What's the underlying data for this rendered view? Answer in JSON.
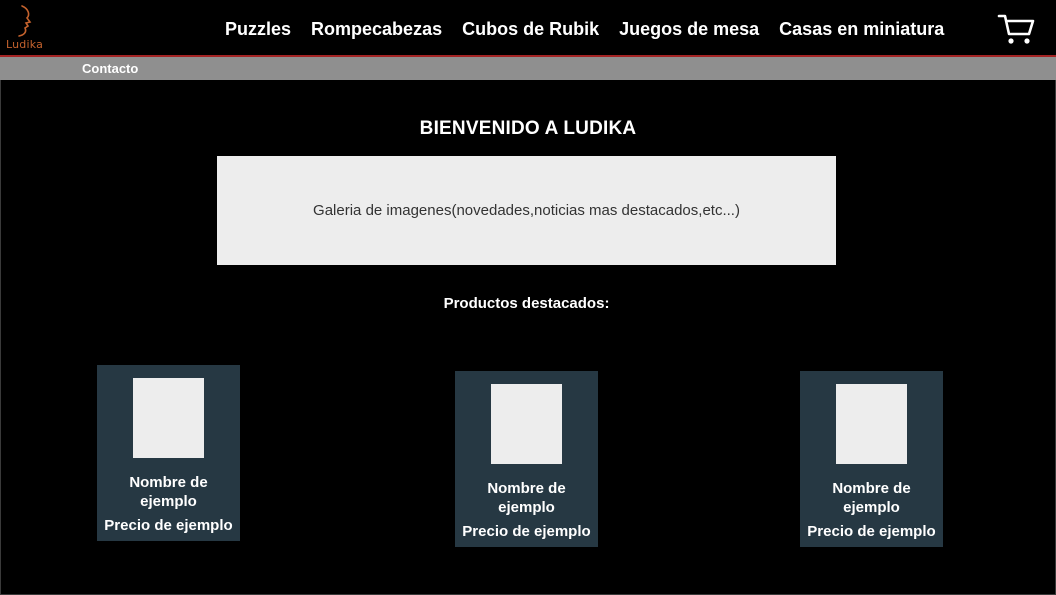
{
  "brand": {
    "logo_text": "Ludika",
    "logo_color": "#c4622d"
  },
  "nav": {
    "items": [
      {
        "label": "Puzzles"
      },
      {
        "label": "Rompecabezas"
      },
      {
        "label": "Cubos de Rubik"
      },
      {
        "label": "Juegos de mesa"
      },
      {
        "label": "Casas en miniatura"
      }
    ],
    "cart_icon": "shopping-cart-icon"
  },
  "subnav": {
    "contact_label": "Contacto"
  },
  "main": {
    "welcome": "BIENVENIDO A LUDIKA",
    "gallery_text": "Galeria de imagenes(novedades,noticias mas destacados,etc...)",
    "featured_title": "Productos destacados:",
    "products": [
      {
        "name": "Nombre de ejemplo",
        "price": "Precio de ejemplo"
      },
      {
        "name": "Nombre de ejemplo",
        "price": "Precio de ejemplo"
      },
      {
        "name": "Nombre de ejemplo",
        "price": "Precio de ejemplo"
      }
    ]
  },
  "colors": {
    "background": "#000000",
    "accent_line": "#a42323",
    "subbar": "#8f8f8f",
    "card": "#263843",
    "placeholder": "#ededed"
  }
}
